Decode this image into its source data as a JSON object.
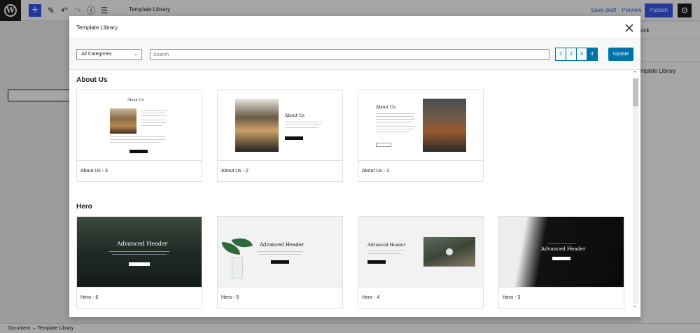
{
  "editor": {
    "doc_title": "Template Library",
    "save_draft": "Save draft",
    "preview": "Preview",
    "publish": "Publish",
    "sidebar_tab": "ock",
    "sidebar_item": "mplate Library",
    "breadcrumb": "Document → Template Library"
  },
  "modal": {
    "title": "Template Library",
    "category_select": "All Categories",
    "search_placeholder": "Search",
    "pages": [
      "1",
      "2",
      "3",
      "4"
    ],
    "active_page": "4",
    "update_label": "Update"
  },
  "sections": [
    {
      "title": "About Us",
      "cards": [
        {
          "label": "About Us - 3",
          "thumb_title": "About Us"
        },
        {
          "label": "About Us - 2",
          "thumb_title": "About Us"
        },
        {
          "label": "About Us - 1",
          "thumb_title": "About Us"
        }
      ]
    },
    {
      "title": "Hero",
      "cards": [
        {
          "label": "Hero - 6",
          "thumb_title": "Advanced Header"
        },
        {
          "label": "Hero - 5",
          "thumb_title": "Advanced Header"
        },
        {
          "label": "Hero - 4",
          "thumb_title": "Advanced Header"
        },
        {
          "label": "Hero - 3",
          "thumb_title": "Advanced Header"
        }
      ]
    }
  ],
  "colors": {
    "accent": "#0073aa",
    "wp_blue": "#3858e9",
    "dark": "#1e1e1e"
  },
  "icons": {
    "close": "close-icon",
    "logo": "wordpress-logo-icon"
  }
}
